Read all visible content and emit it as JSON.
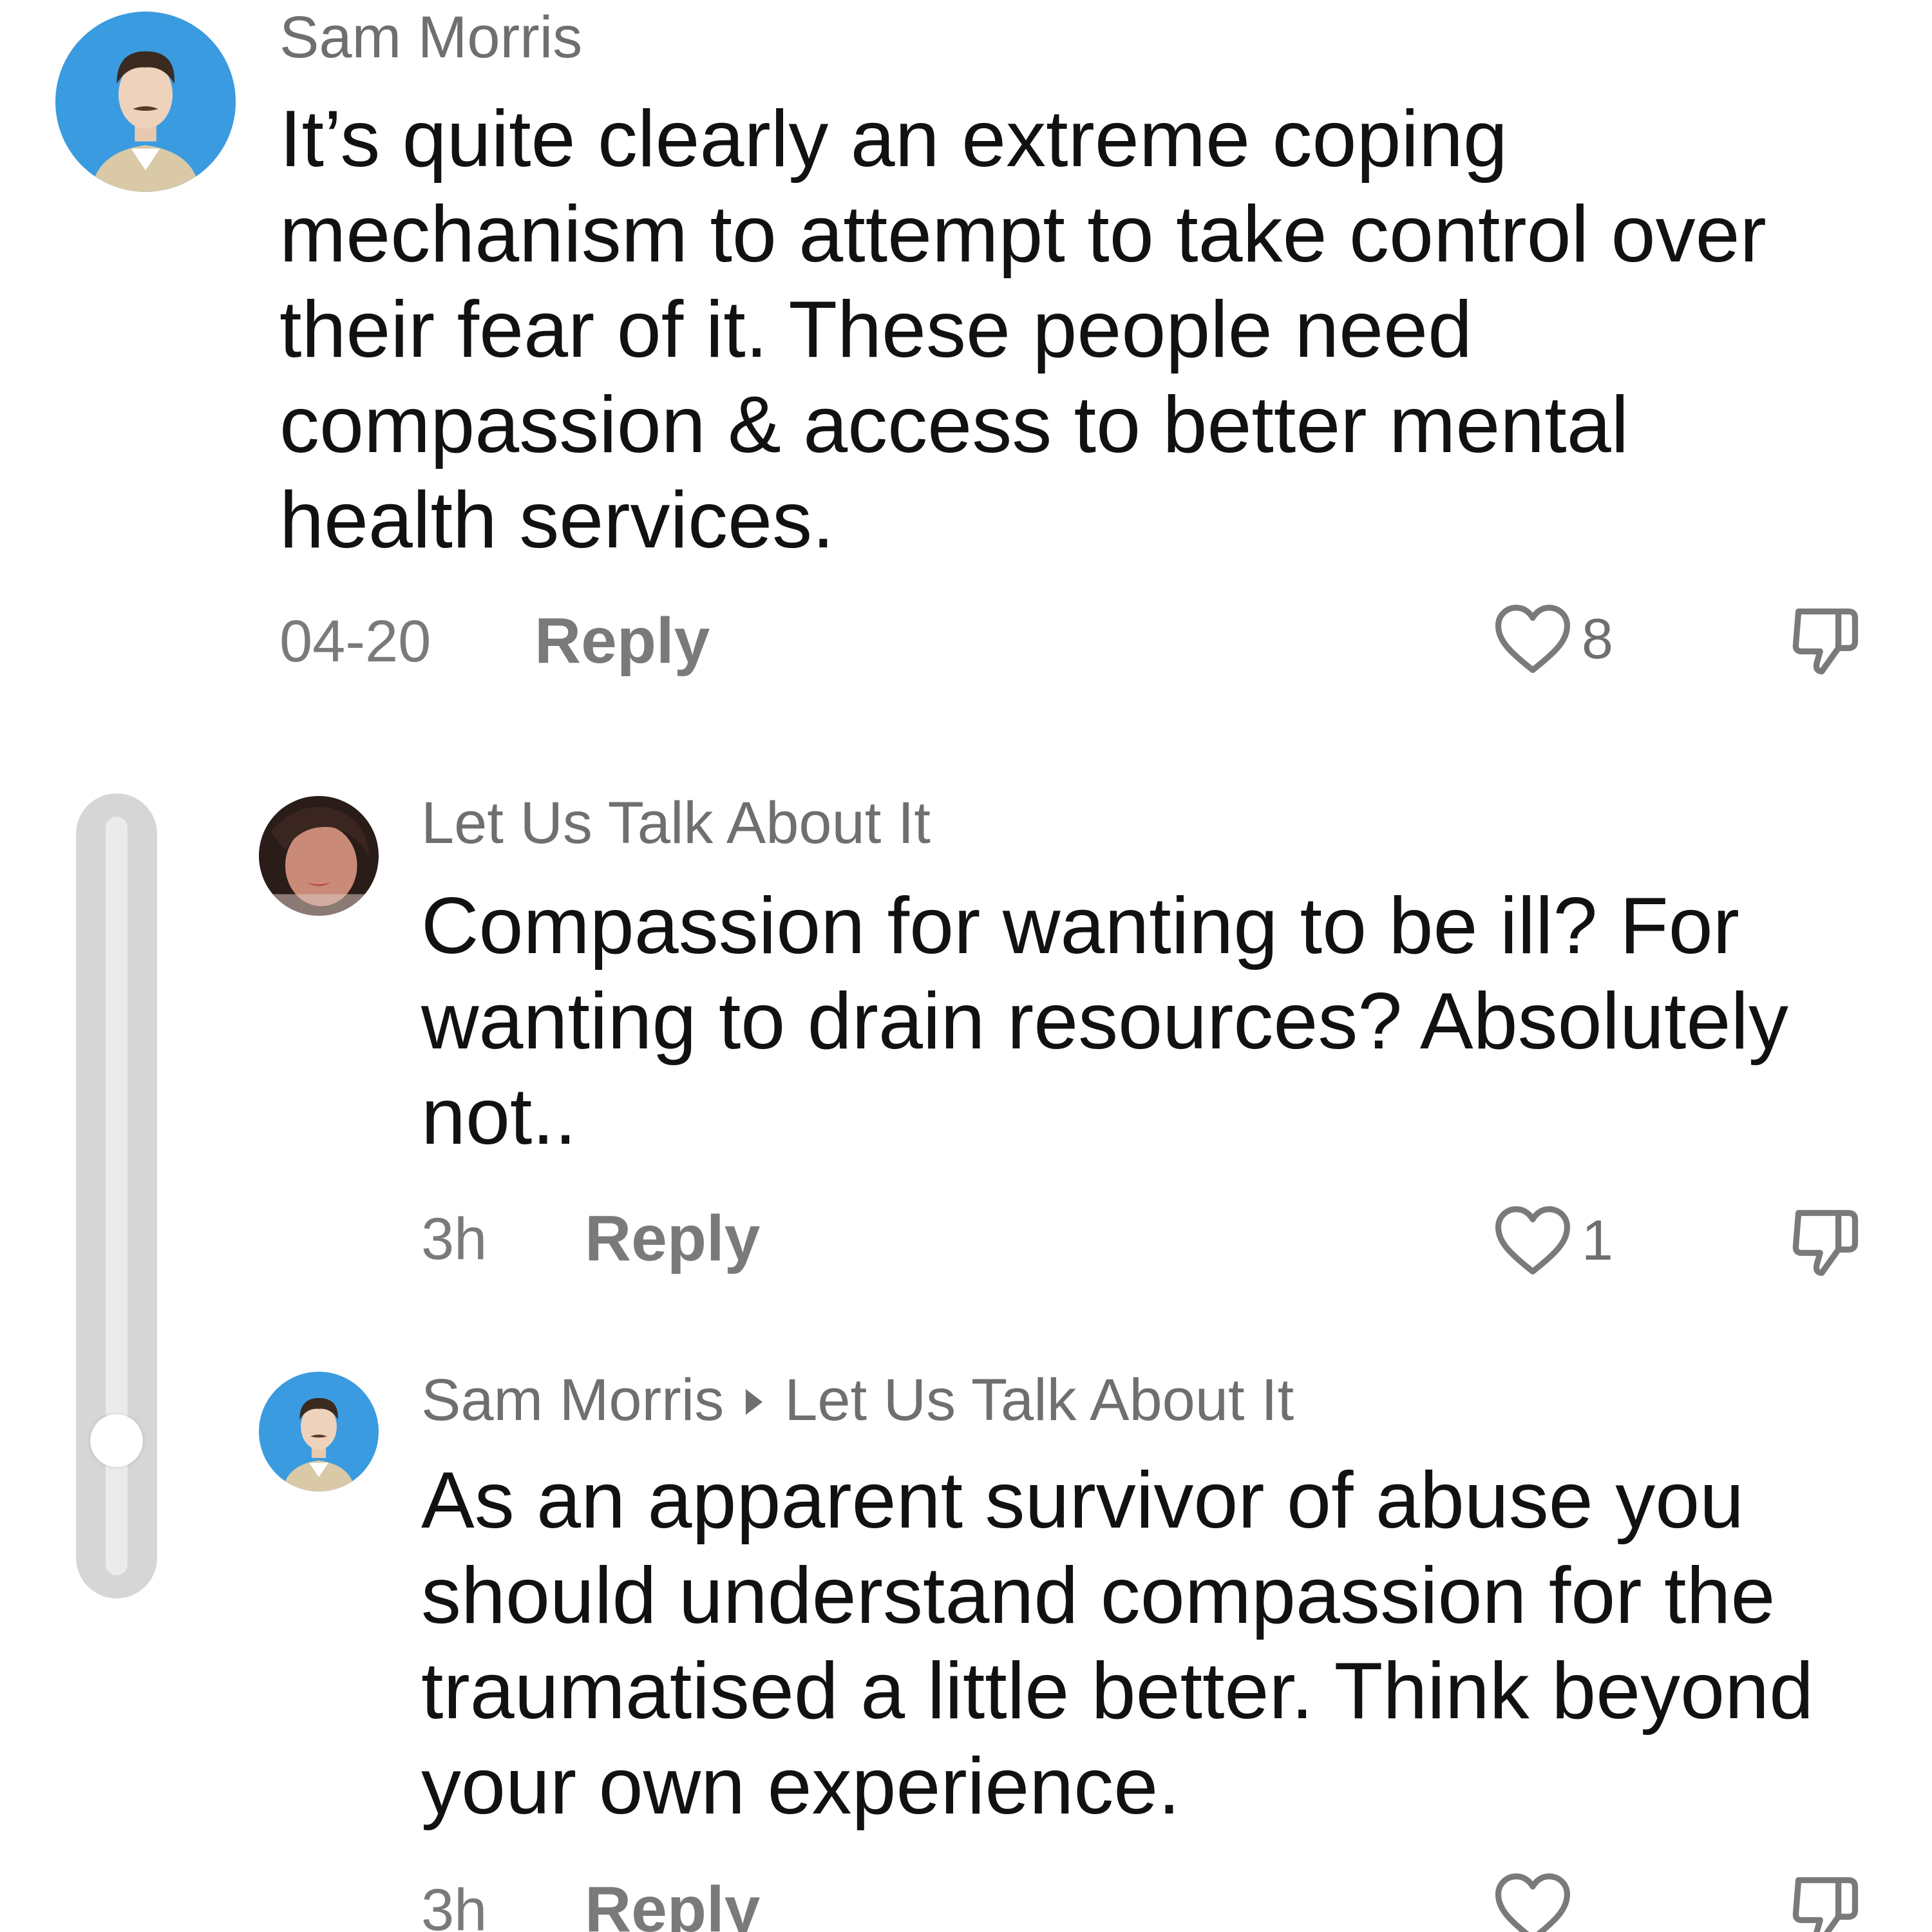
{
  "comments": [
    {
      "author": "Sam Morris",
      "text": "It’s quite clearly an extreme coping mechanism to attempt to take control over their fear of it. These people need compassion & access to better mental health services.",
      "date": "04-20",
      "reply_label": "Reply",
      "like_count": "8"
    },
    {
      "author": "Let Us Talk About It",
      "text": "Compassion for wanting to be ill? For wanting to drain resources? Absolutely not..",
      "date": "3h",
      "reply_label": "Reply",
      "like_count": "1"
    },
    {
      "author": "Sam Morris",
      "reply_to": "Let Us Talk About It",
      "text": "As an apparent survivor of abuse you should understand compassion for the traumatised a little better. Think beyond your own experience.",
      "date": "3h",
      "reply_label": "Reply",
      "like_count": ""
    }
  ],
  "icons": {
    "like": "heart-outline-icon",
    "dislike": "thumbs-down-outline-icon",
    "reply_arrow": "triangle-right-icon"
  },
  "colors": {
    "secondary_text": "#6f6f6f",
    "primary_text": "#111111",
    "avatar_bg_sam": "#3a9be0"
  }
}
